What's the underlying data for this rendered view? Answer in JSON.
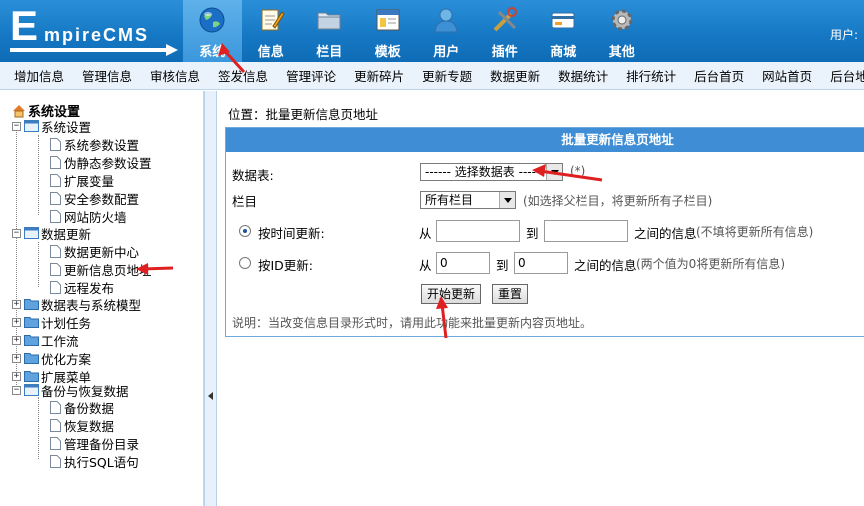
{
  "header": {
    "logo_first": "E",
    "logo_rest": "mpireCMS",
    "user_label": "用户:",
    "nav": [
      {
        "label": "系统",
        "icon": "globe-icon",
        "active": true
      },
      {
        "label": "信息",
        "icon": "pencil-notepad-icon",
        "active": false
      },
      {
        "label": "栏目",
        "icon": "folder-icon",
        "active": false
      },
      {
        "label": "模板",
        "icon": "window-template-icon",
        "active": false
      },
      {
        "label": "用户",
        "icon": "user-icon",
        "active": false
      },
      {
        "label": "插件",
        "icon": "tools-icon",
        "active": false
      },
      {
        "label": "商城",
        "icon": "card-icon",
        "active": false
      },
      {
        "label": "其他",
        "icon": "gear-icon",
        "active": false
      }
    ]
  },
  "subnav": [
    "增加信息",
    "管理信息",
    "审核信息",
    "签发信息",
    "管理评论",
    "更新碎片",
    "更新专题",
    "数据更新",
    "数据统计",
    "排行统计",
    "后台首页",
    "网站首页",
    "后台地图"
  ],
  "sidebar": {
    "root": "系统设置",
    "groups": [
      {
        "label": "系统设置",
        "items": [
          "系统参数设置",
          "伪静态参数设置",
          "扩展变量",
          "安全参数配置",
          "网站防火墙"
        ]
      },
      {
        "label": "数据更新",
        "items": [
          "数据更新中心",
          "更新信息页地址",
          "远程发布"
        ]
      },
      {
        "label": "数据表与系统模型"
      },
      {
        "label": "计划任务"
      },
      {
        "label": "工作流"
      },
      {
        "label": "优化方案"
      },
      {
        "label": "扩展菜单"
      },
      {
        "label": "备份与恢复数据",
        "items": [
          "备份数据",
          "恢复数据",
          "管理备份目录",
          "执行SQL语句"
        ]
      }
    ]
  },
  "main": {
    "breadcrumb": "位置：批量更新信息页地址",
    "panel_title": "批量更新信息页地址",
    "table_label": "数据表:",
    "table_select": "------ 选择数据表 ------",
    "table_hint": "(*)",
    "column_label": "栏目",
    "column_select": "所有栏目",
    "column_hint": "(如选择父栏目，将更新所有子栏目)",
    "by_time_label": "按时间更新:",
    "by_id_label": "按ID更新:",
    "from": "从",
    "to": "到",
    "time_between": "之间的信息",
    "time_hint": "(不填将更新所有信息)",
    "id_between": "之间的信息",
    "id_hint": "(两个值为0将更新所有信息)",
    "id_from_value": "0",
    "id_to_value": "0",
    "start_button": "开始更新",
    "reset_button": "重置",
    "note": "说明：当改变信息目录形式时，请用此功能来批量更新内容页地址。"
  },
  "colors": {
    "header": "#1577c3",
    "panel_title": "#3f8ed5",
    "annotation": "#e02020"
  }
}
